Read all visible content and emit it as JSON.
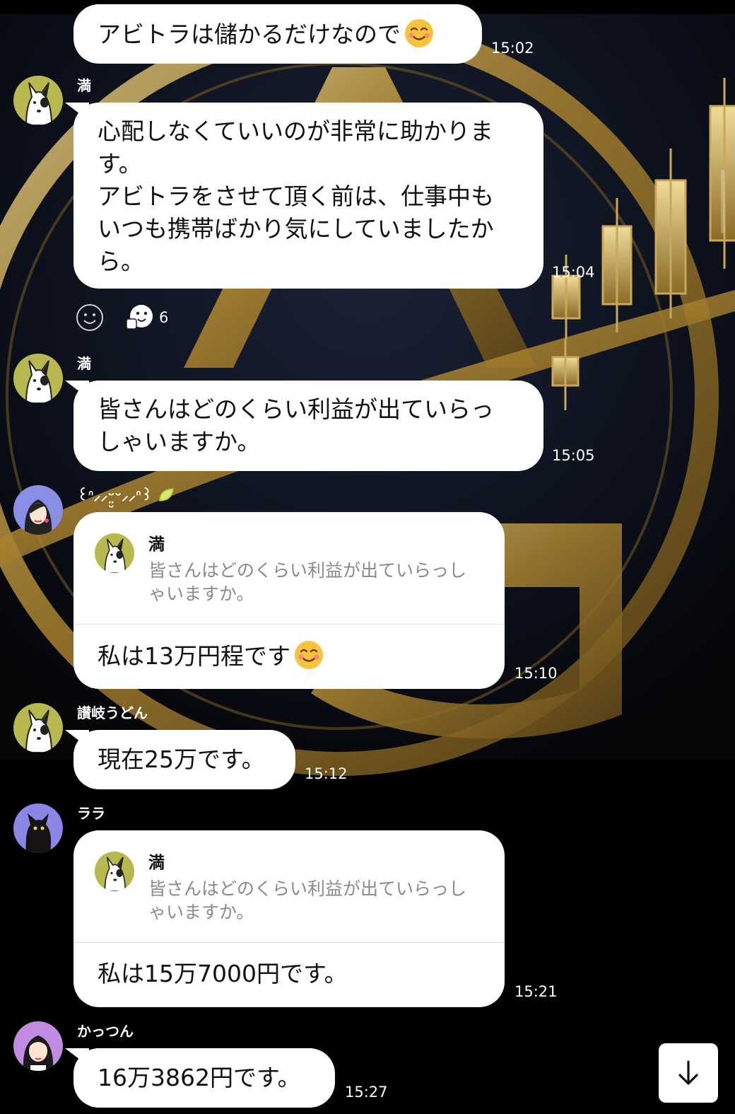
{
  "colors": {
    "background": "#000000",
    "bubble": "#ffffff",
    "gold": "#b8953f",
    "time_text": "#ffffff",
    "quote_text": "#8a8a8a"
  },
  "messages": [
    {
      "id": "m1",
      "sender": "",
      "avatar": "",
      "text": "アビトラは儲かるだけなので",
      "emoji": "smiling-face-icon",
      "time": "15:02"
    },
    {
      "id": "m2",
      "sender": "満",
      "avatar": "dog-avatar",
      "text": "心配しなくていいのが非常に助かりま\nす。\nアビトラをさせて頂く前は、仕事中も\nいつも携帯ばかり気にしていましたか\nら。",
      "time": "15:04",
      "reactions": {
        "emoji": "thumbs-up-face-icon",
        "count": "6"
      }
    },
    {
      "id": "m3",
      "sender": "満",
      "avatar": "dog-avatar",
      "text": "皆さんはどのくらい利益が出ていらっ\nしゃいますか。",
      "time": "15:05"
    },
    {
      "id": "m4",
      "sender": "꒰ᐢ⸝⸝ᵕ̤̮ᵕ⸝⸝ᐢ꒱",
      "sender_emoji": "lime-icon",
      "avatar": "woman-avatar",
      "reply_to": {
        "name": "満",
        "text": "皆さんはどのくらい利益が出ていらっし\nゃいますか。"
      },
      "text": "私は13万円程です",
      "emoji": "smiling-face-icon",
      "time": "15:10"
    },
    {
      "id": "m5",
      "sender": "讃岐うどん",
      "avatar": "dog-avatar",
      "text": "現在25万です。",
      "time": "15:12"
    },
    {
      "id": "m6",
      "sender": "ララ",
      "avatar": "cat-avatar",
      "reply_to": {
        "name": "満",
        "text": "皆さんはどのくらい利益が出ていらっし\nゃいますか。"
      },
      "text": "私は15万7000円です。",
      "time": "15:21"
    },
    {
      "id": "m7",
      "sender": "かっつん",
      "avatar": "girl-avatar",
      "text": "16万3862円です。",
      "time": "15:27"
    }
  ],
  "scroll_button": {
    "icon": "arrow-down-icon"
  }
}
